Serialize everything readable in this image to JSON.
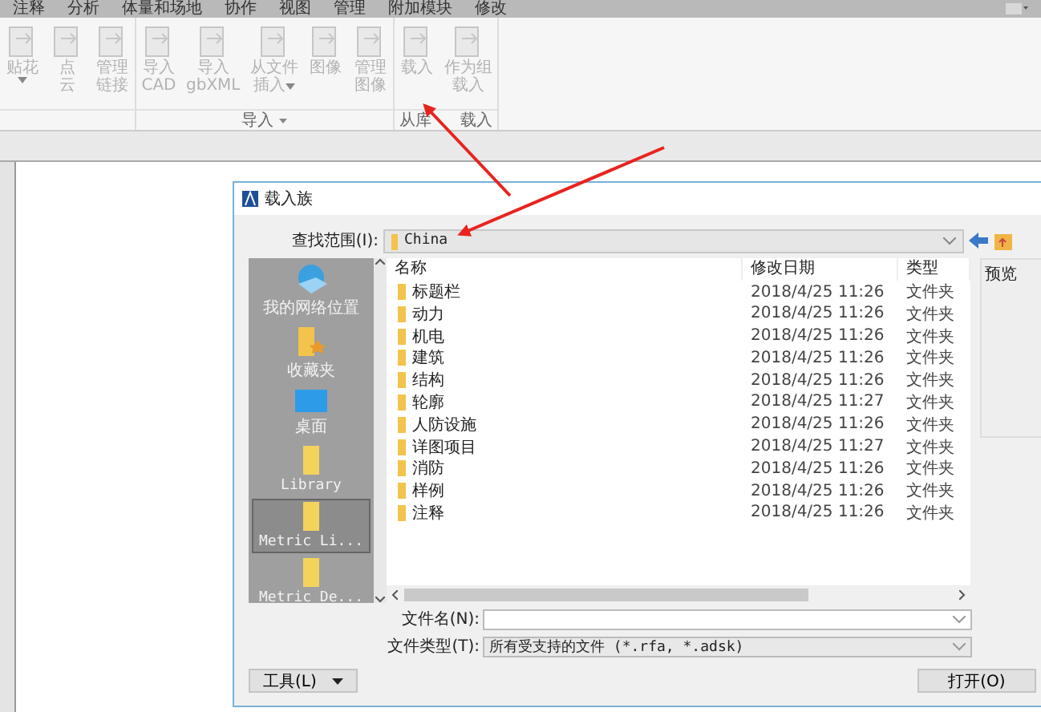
{
  "menu_tabs": [
    "注释",
    "分析",
    "体量和场地",
    "协作",
    "视图",
    "管理",
    "附加模块",
    "修改"
  ],
  "ribbon": {
    "groups": [
      {
        "buttons": [
          {
            "lines": [
              "贴花"
            ],
            "dropdown": true,
            "disabled": true
          },
          {
            "lines": [
              "点",
              "云"
            ],
            "dropdown": false,
            "disabled": true
          },
          {
            "lines": [
              "管理",
              "链接"
            ],
            "dropdown": false,
            "disabled": true
          }
        ]
      },
      {
        "label": "导入",
        "buttons": [
          {
            "lines": [
              "导入",
              "CAD"
            ],
            "dropdown": false,
            "disabled": true
          },
          {
            "lines": [
              "导入",
              "gbXML"
            ],
            "dropdown": false,
            "disabled": true
          },
          {
            "lines": [
              "从文件",
              "插入"
            ],
            "dropdown": true,
            "disabled": true
          },
          {
            "lines": [
              "图像"
            ],
            "dropdown": false,
            "disabled": true
          },
          {
            "lines": [
              "管理",
              "图像"
            ],
            "dropdown": false,
            "disabled": true
          }
        ]
      },
      {
        "label_parts": [
          "从库",
          "载入"
        ],
        "buttons": [
          {
            "lines": [
              "载入"
            ],
            "dropdown": false,
            "disabled": true
          },
          {
            "lines": [
              "作为组",
              "载入"
            ],
            "dropdown": false,
            "disabled": true
          }
        ]
      }
    ]
  },
  "dialog": {
    "title": "载入族",
    "look_in": {
      "label": "查找范围(I):",
      "value": "China"
    },
    "places": [
      {
        "label": "我的网络位置",
        "kind": "network",
        "selected": false
      },
      {
        "label": "收藏夹",
        "kind": "favorites",
        "selected": false
      },
      {
        "label": "桌面",
        "kind": "desktop",
        "selected": false
      },
      {
        "label": "Library",
        "kind": "folder",
        "selected": false
      },
      {
        "label": "Metric Li...",
        "kind": "folder",
        "selected": true
      },
      {
        "label": "Metric De...",
        "kind": "folder",
        "selected": false
      }
    ],
    "columns": [
      "名称",
      "修改日期",
      "类型"
    ],
    "rows": [
      {
        "name": "标题栏",
        "date": "2018/4/25 11:26",
        "type": "文件夹"
      },
      {
        "name": "动力",
        "date": "2018/4/25 11:26",
        "type": "文件夹"
      },
      {
        "name": "机电",
        "date": "2018/4/25 11:26",
        "type": "文件夹"
      },
      {
        "name": "建筑",
        "date": "2018/4/25 11:26",
        "type": "文件夹"
      },
      {
        "name": "结构",
        "date": "2018/4/25 11:26",
        "type": "文件夹"
      },
      {
        "name": "轮廓",
        "date": "2018/4/25 11:27",
        "type": "文件夹"
      },
      {
        "name": "人防设施",
        "date": "2018/4/25 11:26",
        "type": "文件夹"
      },
      {
        "name": "详图项目",
        "date": "2018/4/25 11:27",
        "type": "文件夹"
      },
      {
        "name": "消防",
        "date": "2018/4/25 11:26",
        "type": "文件夹"
      },
      {
        "name": "样例",
        "date": "2018/4/25 11:26",
        "type": "文件夹"
      },
      {
        "name": "注释",
        "date": "2018/4/25 11:26",
        "type": "文件夹"
      }
    ],
    "preview_label": "预览",
    "file_name": {
      "label": "文件名(N):"
    },
    "file_type": {
      "label": "文件类型(T):",
      "value": "所有受支持的文件 (*.rfa, *.adsk)"
    },
    "tools_button": "工具(L)",
    "open_button": "打开(O)"
  }
}
